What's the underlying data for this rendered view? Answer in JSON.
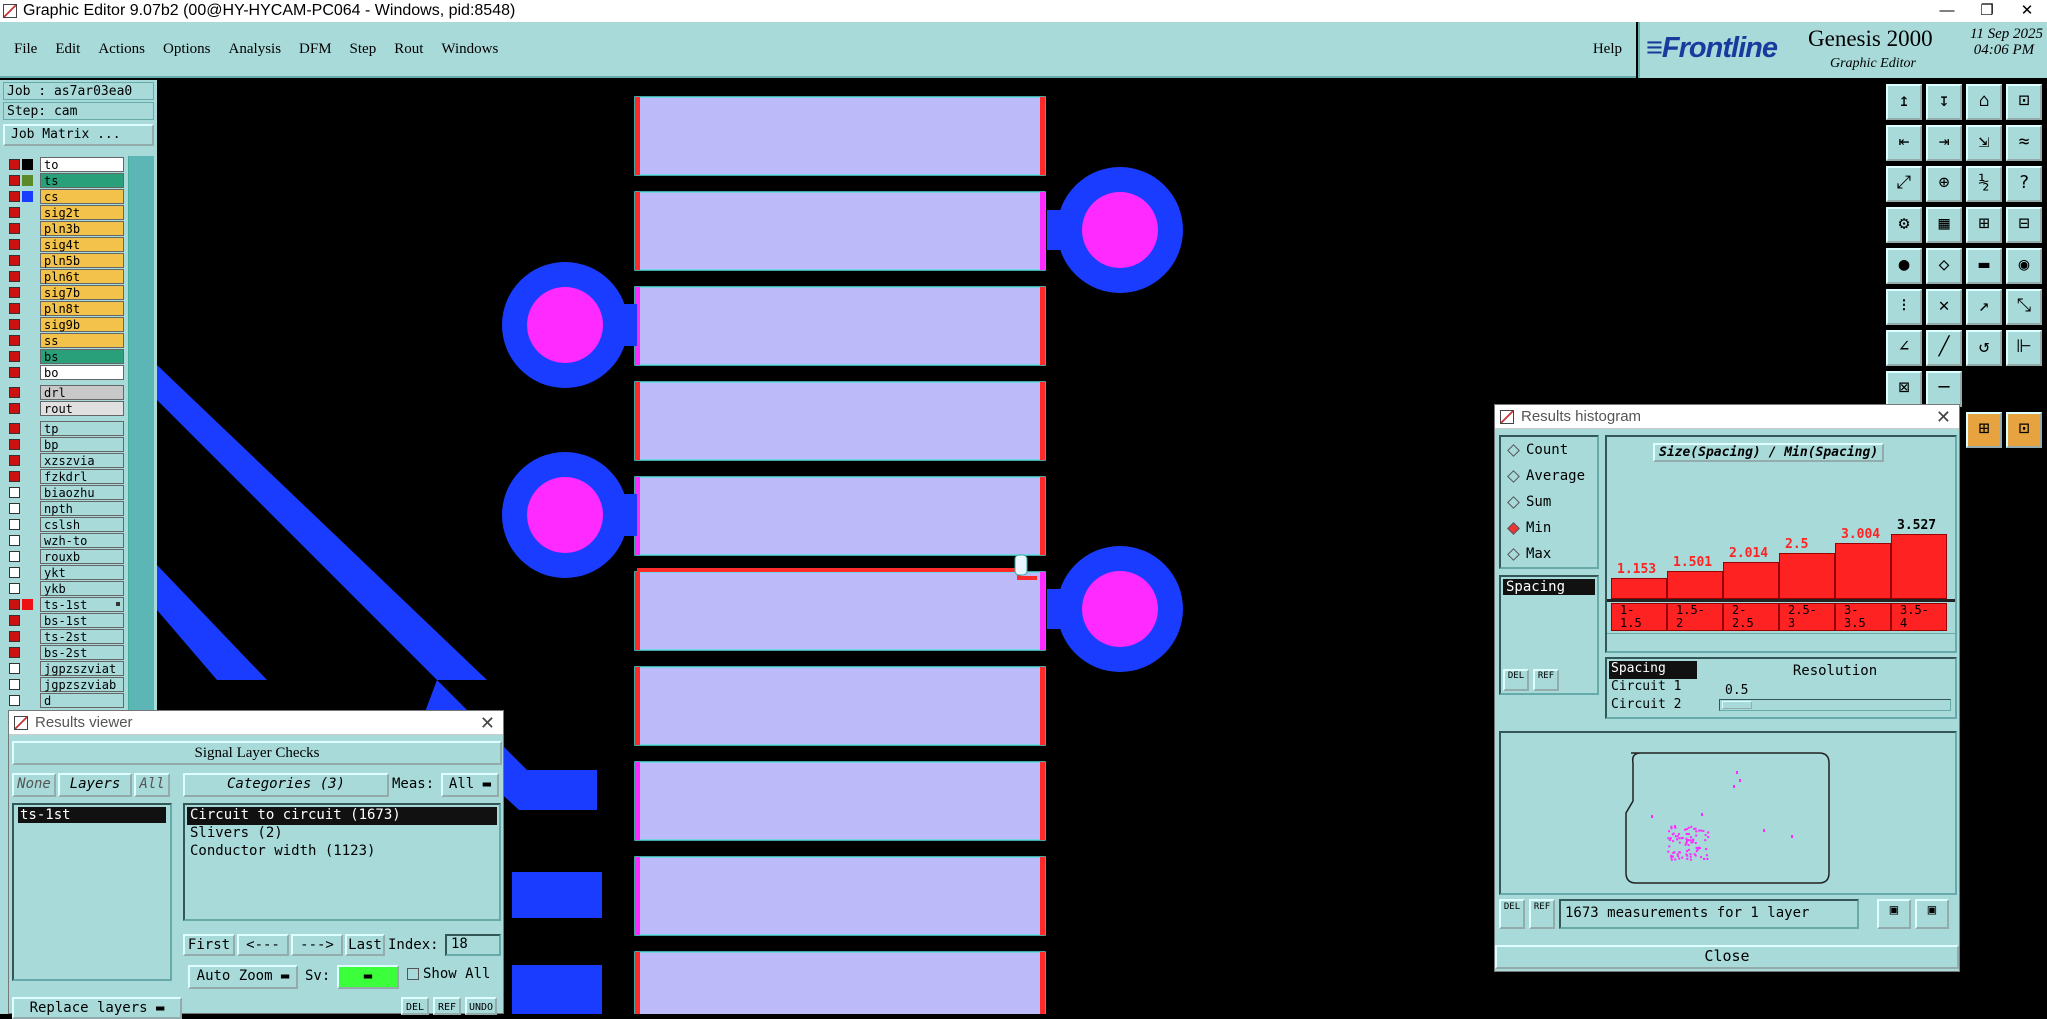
{
  "window": {
    "title": "Graphic Editor 9.07b2 (00@HY-HYCAM-PC064 - Windows, pid:8548)",
    "min": "—",
    "max": "❐",
    "close": "✕"
  },
  "menu": [
    "File",
    "Edit",
    "Actions",
    "Options",
    "Analysis",
    "DFM",
    "Step",
    "Rout",
    "Windows"
  ],
  "help": "Help",
  "brand": {
    "logo": "≡Frontline",
    "product": "Genesis 2000",
    "subtitle": "Graphic Editor",
    "date": "11 Sep 2025",
    "time": "04:06 PM"
  },
  "left": {
    "job": "Job : as7ar03ea0",
    "step": "Step: cam",
    "matrix": "Job Matrix ..."
  },
  "layers": [
    {
      "name": "to",
      "bg": "#ffffff",
      "color": "#000000"
    },
    {
      "name": "ts",
      "bg": "#2aa07a",
      "color": "#5a8a2a"
    },
    {
      "name": "cs",
      "bg": "#f3c24a",
      "color": "#1a3cff"
    },
    {
      "name": "sig2t",
      "bg": "#f3c24a",
      "color": ""
    },
    {
      "name": "pln3b",
      "bg": "#f3c24a",
      "color": ""
    },
    {
      "name": "sig4t",
      "bg": "#f3c24a",
      "color": ""
    },
    {
      "name": "pln5b",
      "bg": "#f3c24a",
      "color": ""
    },
    {
      "name": "pln6t",
      "bg": "#f3c24a",
      "color": ""
    },
    {
      "name": "sig7b",
      "bg": "#f3c24a",
      "color": ""
    },
    {
      "name": "pln8t",
      "bg": "#f3c24a",
      "color": ""
    },
    {
      "name": "sig9b",
      "bg": "#f3c24a",
      "color": ""
    },
    {
      "name": "ss",
      "bg": "#f3c24a",
      "color": ""
    },
    {
      "name": "bs",
      "bg": "#2aa07a",
      "color": ""
    },
    {
      "name": "bo",
      "bg": "#ffffff",
      "color": ""
    },
    {
      "name": "drl",
      "bg": "#c8c8c8",
      "color": "",
      "gap": true
    },
    {
      "name": "rout",
      "bg": "#e0e0e0",
      "color": ""
    },
    {
      "name": "tp",
      "bg": "#a8dada",
      "color": "",
      "gap": true
    },
    {
      "name": "bp",
      "bg": "#a8dada",
      "color": ""
    },
    {
      "name": "xzszvia",
      "bg": "#a8dada",
      "color": ""
    },
    {
      "name": "fzkdrl",
      "bg": "#a8dada",
      "color": ""
    },
    {
      "name": "biaozhu",
      "bg": "#a8dada",
      "color": "",
      "empty": true
    },
    {
      "name": "npth",
      "bg": "#a8dada",
      "color": "",
      "empty": true
    },
    {
      "name": "cslsh",
      "bg": "#a8dada",
      "color": "",
      "empty": true
    },
    {
      "name": "wzh-to",
      "bg": "#a8dada",
      "color": "",
      "empty": true
    },
    {
      "name": "rouxb",
      "bg": "#a8dada",
      "color": "",
      "empty": true
    },
    {
      "name": "ykt",
      "bg": "#a8dada",
      "color": "",
      "empty": true
    },
    {
      "name": "ykb",
      "bg": "#a8dada",
      "color": "",
      "empty": true
    },
    {
      "name": "ts-1st",
      "bg": "#a8dada",
      "color": "#ee1111",
      "active": true
    },
    {
      "name": "bs-1st",
      "bg": "#a8dada",
      "color": ""
    },
    {
      "name": "ts-2st",
      "bg": "#a8dada",
      "color": ""
    },
    {
      "name": "bs-2st",
      "bg": "#a8dada",
      "color": ""
    },
    {
      "name": "jgpzszviat",
      "bg": "#a8dada",
      "color": "",
      "empty": true
    },
    {
      "name": "jgpzszviab",
      "bg": "#a8dada",
      "color": "",
      "empty": true
    },
    {
      "name": "d",
      "bg": "#a8dada",
      "color": "",
      "empty": true
    }
  ],
  "results_viewer": {
    "title": "Results viewer",
    "heading": "Signal Layer Checks",
    "none": "None",
    "layers": "Layers",
    "all": "All",
    "categories": "Categories (3)",
    "meas_label": "Meas:",
    "meas_value": "All",
    "layer_list": [
      "ts-1st"
    ],
    "category_list": [
      "Circuit to circuit (1673)",
      "Slivers (2)",
      "Conductor width (1123)"
    ],
    "first": "First",
    "prev": "<---",
    "next": "--->",
    "last": "Last",
    "index_label": "Index:",
    "index_value": "18",
    "auto_zoom": "Auto Zoom",
    "sv": "Sv:",
    "show_all": "Show All",
    "replace_layers": "Replace layers",
    "del": "DEL",
    "ref": "REF",
    "undo": "UNDO"
  },
  "histogram": {
    "title": "Results histogram",
    "modes": [
      "Count",
      "Average",
      "Sum",
      "Min",
      "Max"
    ],
    "selected_mode": "Min",
    "type_list": [
      "Spacing"
    ],
    "chart_title": "Size(Spacing) / Min(Spacing)",
    "bins": [
      "1-\n1.5",
      "1.5-\n2",
      "2-\n2.5",
      "2.5-\n3",
      "3-\n3.5",
      "3.5-\n4"
    ],
    "values": [
      1.153,
      1.501,
      2.014,
      2.5,
      3.004,
      3.527
    ],
    "value_labels": [
      "1.153",
      "1.501",
      "2.014",
      "2.5",
      "3.004",
      "3.527"
    ],
    "ymax": 4,
    "props": [
      "Spacing",
      "Circuit 1",
      "Circuit 2"
    ],
    "resolution_label": "Resolution",
    "resolution_value": "0.5",
    "status": "1673 measurements for 1 layer",
    "close": "Close",
    "del": "DEL",
    "ref": "REF"
  },
  "chart_data": {
    "type": "bar",
    "title": "Size(Spacing) / Min(Spacing)",
    "categories": [
      "1-1.5",
      "1.5-2",
      "2-2.5",
      "2.5-3",
      "3-3.5",
      "3.5-4"
    ],
    "values": [
      1.153,
      1.501,
      2.014,
      2.5,
      3.004,
      3.527
    ]
  },
  "colors": {
    "pad": "#bcbaf8",
    "copper": "#1a3cff",
    "via": "#ff2aff",
    "error": "#ff2a2a",
    "panel": "#a8dada"
  }
}
